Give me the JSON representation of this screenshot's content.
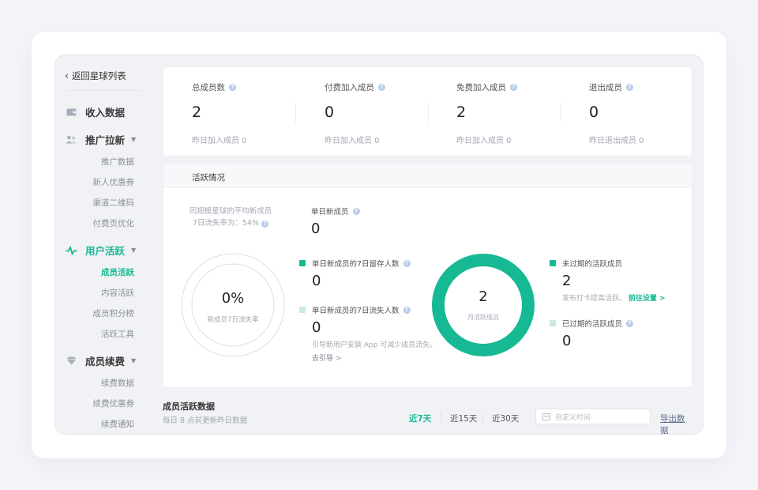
{
  "sidebar": {
    "back_label": "返回星球列表",
    "groups": [
      {
        "label": "收入数据",
        "icon": "wallet-icon",
        "has_caret": false
      },
      {
        "label": "推广拉新",
        "icon": "users-icon",
        "has_caret": true,
        "items": [
          "推广数据",
          "新人优惠券",
          "渠道二维码",
          "付费页优化"
        ]
      },
      {
        "label": "用户活跃",
        "icon": "pulse-icon",
        "has_caret": true,
        "active": true,
        "items": [
          "成员活跃",
          "内容活跃",
          "成员积分榜",
          "活跃工具"
        ],
        "active_item": "成员活跃"
      },
      {
        "label": "成员续费",
        "icon": "gem-icon",
        "has_caret": true,
        "items": [
          "续费数据",
          "续费优惠券",
          "续费通知"
        ]
      }
    ]
  },
  "stats": [
    {
      "label": "总成员数",
      "value": "2",
      "sub": "昨日加入成员 0"
    },
    {
      "label": "付费加入成员",
      "value": "0",
      "sub": "昨日加入成员 0"
    },
    {
      "label": "免费加入成员",
      "value": "2",
      "sub": "昨日加入成员 0"
    },
    {
      "label": "退出成员",
      "value": "0",
      "sub": "昨日退出成员 0"
    }
  ],
  "active_section": {
    "title": "活跃情况",
    "avg_text_line1": "同规模星球的平均新成员",
    "avg_text_line2": "7日流失率为：54%",
    "left_ring": {
      "value": "0%",
      "caption": "新成员7日流失率"
    },
    "daily_new": {
      "label": "单日新成员",
      "value": "0"
    },
    "retained": {
      "label": "单日新成员的7日留存人数",
      "value": "0",
      "color": "#17b994"
    },
    "lost": {
      "label": "单日新成员的7日流失人数",
      "value": "0",
      "color": "#c9eadf",
      "note": "引导新用户安装 App 可减少成员流失。",
      "link": "去引导 >"
    },
    "right_ring": {
      "value": "2",
      "caption": "月活跃成员",
      "color": "#17b994"
    },
    "unexpired": {
      "label": "未过期的活跃成员",
      "value": "2",
      "color": "#17b994",
      "note": "发布打卡提高活跃。",
      "link": "前往设置 >"
    },
    "expired": {
      "label": "已过期的活跃成员",
      "value": "0",
      "color": "#c9eadf"
    }
  },
  "member_activity": {
    "title": "成员活跃数据",
    "subtitle": "每日 8 点前更新昨日数据",
    "ranges": [
      "近7天",
      "近15天",
      "近30天"
    ],
    "active_range": "近7天",
    "date_placeholder": "自定义时间",
    "export_label": "导出数据"
  },
  "colors": {
    "accent": "#17b994",
    "accent_light": "#c9eadf"
  }
}
